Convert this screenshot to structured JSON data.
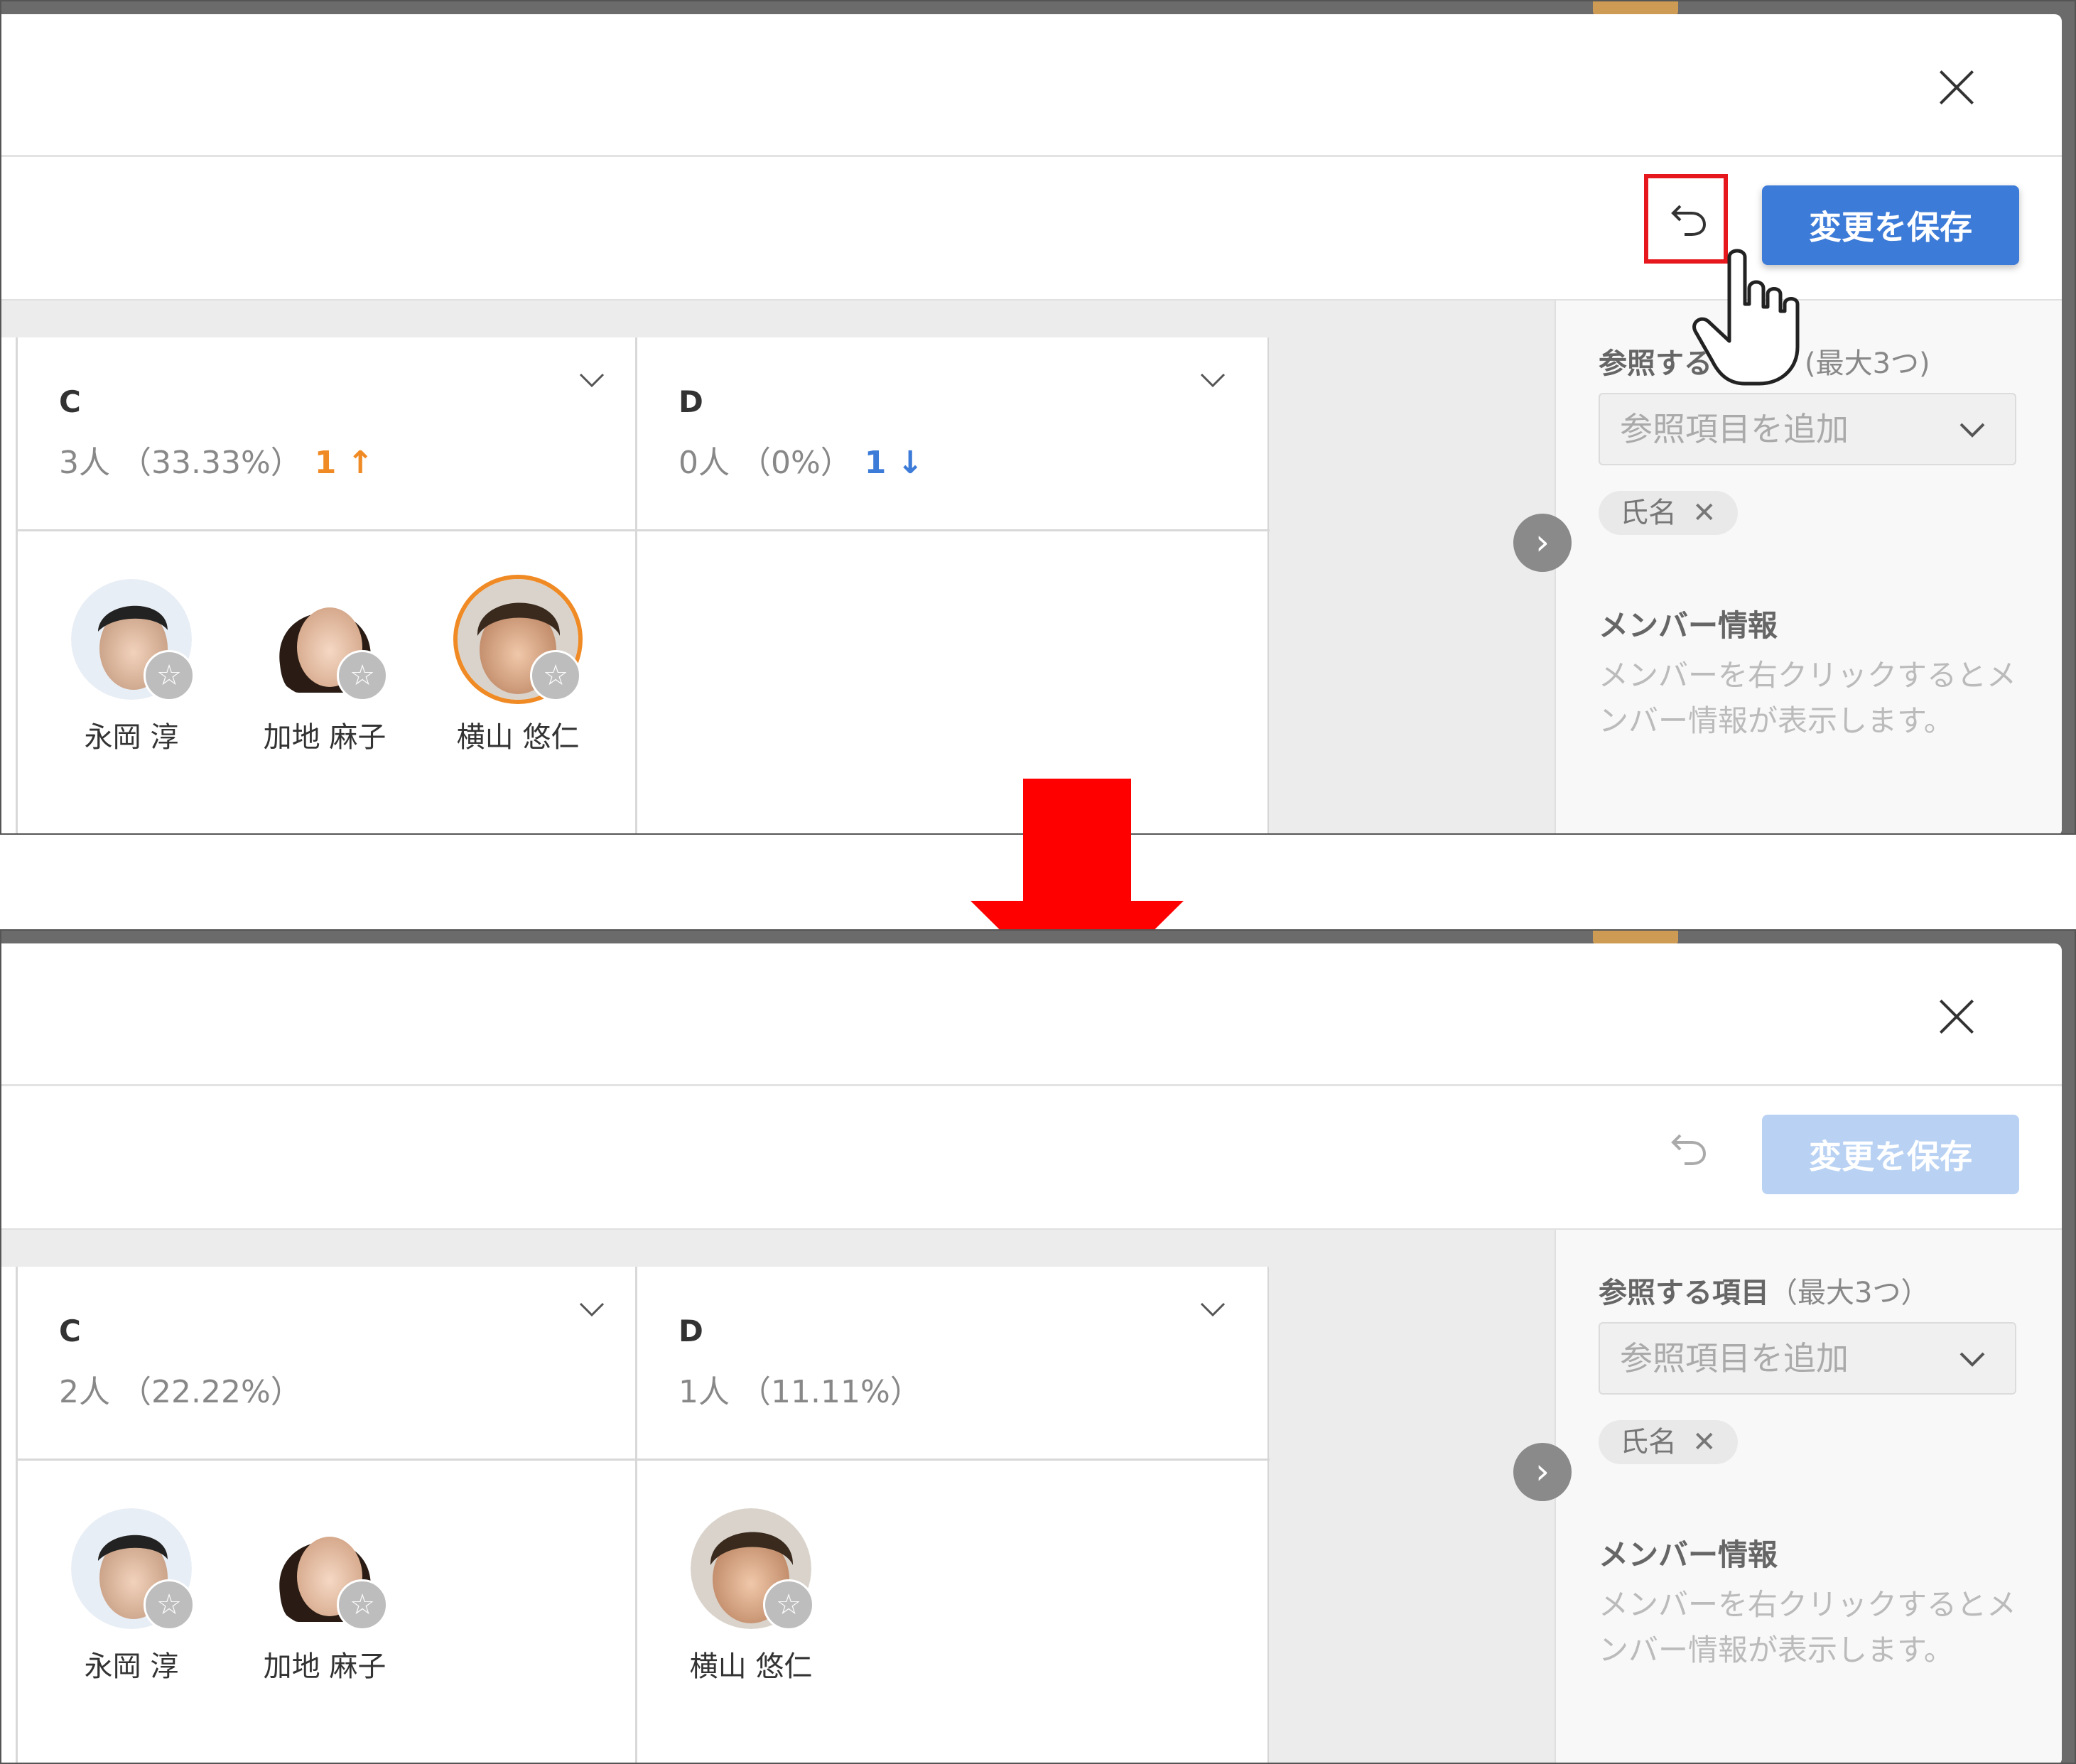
{
  "colors": {
    "primary": "#3d7bd8",
    "primary_disabled": "#b9d2f3",
    "increase": "#f08a24",
    "decrease": "#3d7bd8",
    "highlight_box": "#e6181e"
  },
  "before": {
    "save_label": "変更を保存",
    "columns": [
      {
        "name": "C",
        "stat": "3人 （33.33%）",
        "change": "1 ↑",
        "members": [
          "永岡 淳",
          "加地 麻子",
          "横山 悠仁"
        ]
      },
      {
        "name": "D",
        "stat": "0人 （0%）",
        "change": "1 ↓",
        "members": []
      }
    ],
    "side": {
      "ref_label_bold": "参照する",
      "ref_label_light": "(最大3つ)",
      "select_placeholder": "参照項目を追加",
      "tag": "氏名",
      "tag_close": "✕",
      "info_title": "メンバー情報",
      "info_text": "メンバーを右クリックするとメンバー情報が表示します。"
    }
  },
  "after": {
    "save_label": "変更を保存",
    "columns": [
      {
        "name": "C",
        "stat": "2人 （22.22%）",
        "members": [
          "永岡 淳",
          "加地 麻子"
        ]
      },
      {
        "name": "D",
        "stat": "1人 （11.11%）",
        "members": [
          "横山 悠仁"
        ]
      }
    ],
    "side": {
      "ref_label_bold": "参照する項目",
      "ref_label_light": "（最大3つ）",
      "select_placeholder": "参照項目を追加",
      "tag": "氏名",
      "tag_close": "✕",
      "info_title": "メンバー情報",
      "info_text": "メンバーを右クリックするとメンバー情報が表示します。"
    }
  },
  "icons": {
    "close": "close-icon",
    "undo": "undo-icon",
    "chevron": "chevron-down-icon",
    "star": "star-icon",
    "pointer": "hand-pointer-icon",
    "arrow": "down-arrow-icon"
  },
  "star_glyph": "☆",
  "side_toggle_glyph": "›"
}
